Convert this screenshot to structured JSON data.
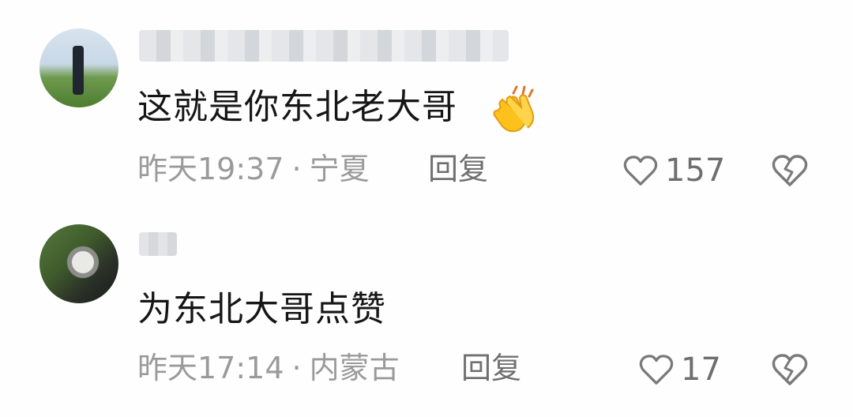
{
  "comments": [
    {
      "content": "这就是你东北老大哥",
      "emoji": "clapping-hands",
      "time": "昨天19:37",
      "separator": "·",
      "location": "宁夏",
      "reply_label": "回复",
      "like_count": "157"
    },
    {
      "content": "为东北大哥点赞",
      "time": "昨天17:14",
      "separator": "·",
      "location": "内蒙古",
      "reply_label": "回复",
      "like_count": "17"
    }
  ],
  "colors": {
    "text": "#161616",
    "meta": "#9a9a9a",
    "icon": "#7a7a7a",
    "background": "#fefefe"
  }
}
